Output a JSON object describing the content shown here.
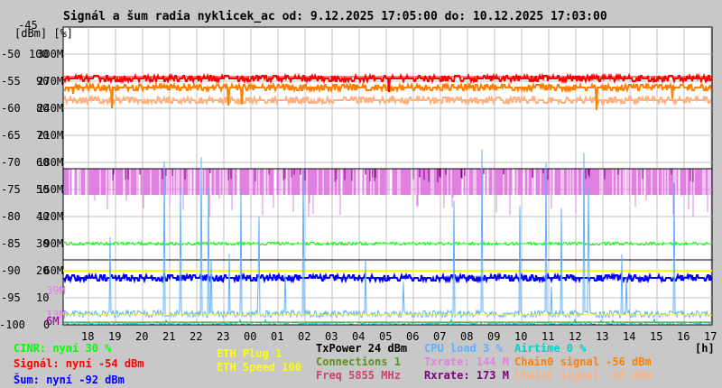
{
  "chart_data": {
    "type": "line",
    "title": "Signál a šum radia nyklicek_ac od: 9.12.2025 17:05:00 do: 10.12.2025 17:03:00",
    "y_unit_labels": "[dBm] [%]",
    "x_unit": "[h]",
    "x_ticks": [
      "18",
      "19",
      "20",
      "21",
      "22",
      "23",
      "00",
      "01",
      "02",
      "03",
      "04",
      "05",
      "06",
      "07",
      "08",
      "09",
      "10",
      "11",
      "12",
      "13",
      "14",
      "15",
      "16",
      "17"
    ],
    "y_ticks_dbm": [
      "-45",
      "-50",
      "-55",
      "-60",
      "-65",
      "-70",
      "-75",
      "-80",
      "-85",
      "-90",
      "-95",
      "-100"
    ],
    "y_ticks_pct": [
      "100",
      "90",
      "80",
      "70",
      "60",
      "50",
      "40",
      "30",
      "20",
      "10",
      "0"
    ],
    "y_ticks_rate": [
      "300M",
      "270M",
      "240M",
      "210M",
      "180M",
      "150M",
      "120M",
      "90M",
      "60M"
    ],
    "extra_rate_marks": [
      {
        "label": "39M",
        "color": "#e080e0"
      },
      {
        "label": "13M",
        "color": "#e080e0"
      },
      {
        "label": "6M",
        "color": "#800080"
      }
    ],
    "ylim_dbm": [
      -100,
      -45
    ],
    "ylim_pct": [
      0,
      100
    ],
    "ylim_rate": [
      0,
      300
    ],
    "grid": true,
    "series": [
      {
        "name": "Signál",
        "unit": "dBm",
        "level": -54.5,
        "color": "#ff0000"
      },
      {
        "name": "Chain0 signal",
        "unit": "dBm",
        "level": -56,
        "color": "#ff8000"
      },
      {
        "name": "Chain1 signal",
        "unit": "dBm",
        "level": -58.5,
        "color": "#ffb080"
      },
      {
        "name": "CINR",
        "unit": "%",
        "level": 30,
        "color": "#00ff00"
      },
      {
        "name": "Šum",
        "unit": "dBm",
        "level": -92,
        "color": "#0000ff"
      },
      {
        "name": "Txrate",
        "unit": "M",
        "level": 144,
        "color": "#e080e0"
      },
      {
        "name": "Rxrate",
        "unit": "M",
        "level": 173,
        "color": "#800080"
      },
      {
        "name": "CPU load",
        "unit": "%",
        "level": 4,
        "color": "#60b0ff"
      },
      {
        "name": "Airtime",
        "unit": "%",
        "level": 0,
        "color": "#00d0d0"
      },
      {
        "name": "ETH Speed",
        "unit": "M",
        "level": 100,
        "color": "#ffff00"
      }
    ]
  },
  "legend": {
    "cinr": "CINR: nyní 30 %",
    "signal": "Signál: nyní -54 dBm",
    "noise": "Šum: nyní -92 dBm",
    "eth_plug": "ETH Plug 1",
    "eth_speed": "ETH Speed 100",
    "txpower": "TxPower 24 dBm",
    "connections": "Connections 1",
    "freq": "Freq 5855 MHz",
    "cpu": "CPU load 3 %",
    "txrate": "Txrate: 144 M",
    "rxrate": "Rxrate: 173 M",
    "airtime": "Airtime 0 %",
    "chain0": "Chain0 signal -56 dBm",
    "chain1": "Chain1 signal -58 dBm"
  }
}
